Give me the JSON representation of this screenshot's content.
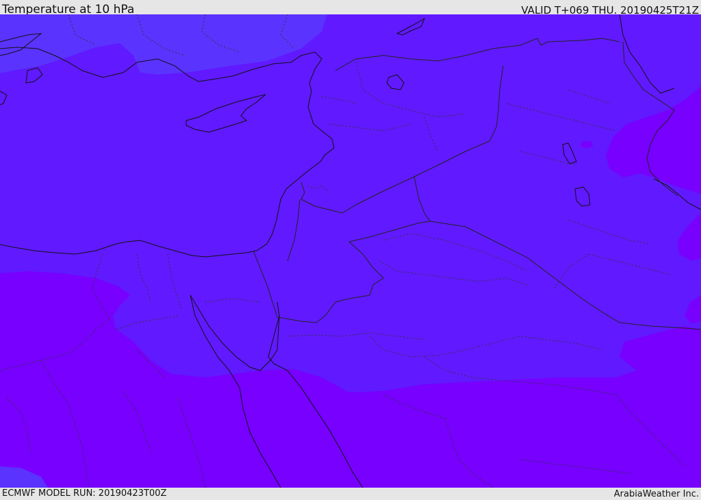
{
  "header": {
    "title": "Temperature at 10 hPa",
    "valid_time": "VALID T+069 THU. 20190425T21Z"
  },
  "footer": {
    "model_run": "ECMWF MODEL RUN: 20190423T00Z",
    "credit": "ArabiaWeather Inc."
  },
  "map": {
    "colors": {
      "band_cold": "#5a33ff",
      "band_mid": "#6119ff",
      "band_warm": "#7700ff",
      "coastline": "#111111",
      "border": "#222222"
    }
  }
}
